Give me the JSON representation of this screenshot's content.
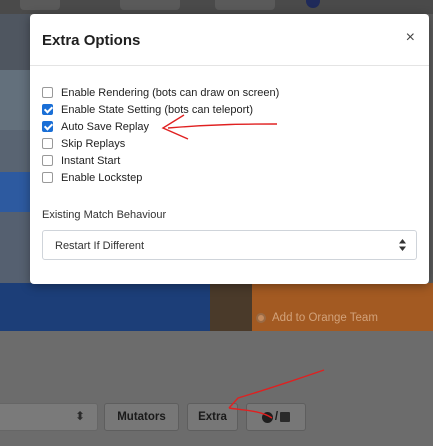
{
  "modal": {
    "title": "Extra Options",
    "close_glyph": "×",
    "options": [
      {
        "label": "Enable Rendering (bots can draw on screen)",
        "checked": false
      },
      {
        "label": "Enable State Setting (bots can teleport)",
        "checked": true
      },
      {
        "label": "Auto Save Replay",
        "checked": true
      },
      {
        "label": "Skip Replays",
        "checked": false
      },
      {
        "label": "Instant Start",
        "checked": false
      },
      {
        "label": "Enable Lockstep",
        "checked": false
      }
    ],
    "match_behaviour": {
      "label": "Existing Match Behaviour",
      "value": "Restart If Different"
    }
  },
  "background": {
    "orange_team_label": "Add to Orange Team",
    "toolbar": {
      "select_caret": "⬍",
      "mutators_label": "Mutators",
      "extra_label": "Extra",
      "launcher_separator": "/"
    }
  },
  "colors": {
    "checkbox_accent": "#1a6fd6",
    "annotation_red": "#e02020",
    "blue_team": "#1c3e78",
    "orange_team": "#a35a22"
  },
  "icons": {
    "close": "close-icon",
    "select_arrow": "select-caret-icon",
    "launcher_a": "rocket-league-icon",
    "launcher_b": "steam-icon"
  }
}
